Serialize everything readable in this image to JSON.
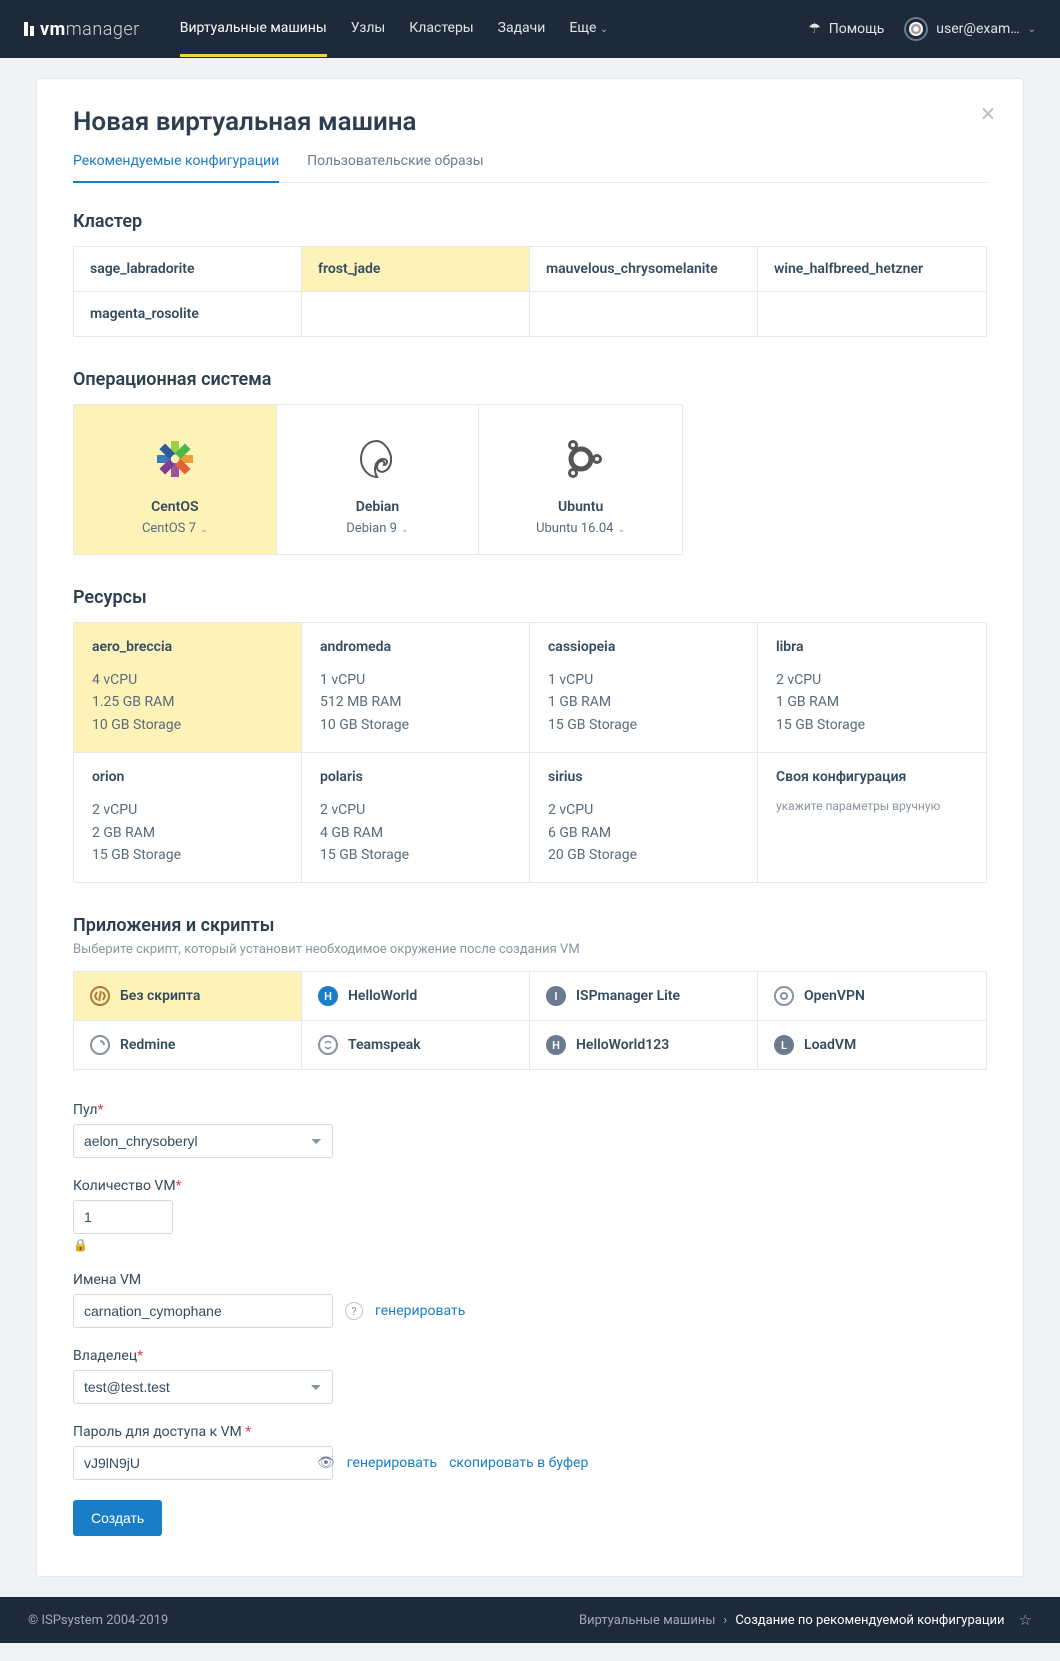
{
  "brand": {
    "bold": "vm",
    "thin": "manager"
  },
  "nav": {
    "items": [
      "Виртуальные машины",
      "Узлы",
      "Кластеры",
      "Задачи",
      "Еще"
    ],
    "active_index": 0
  },
  "header": {
    "help": "Помощь",
    "user": "user@exam…"
  },
  "page": {
    "title": "Новая виртуальная машина",
    "tabs": [
      "Рекомендуемые конфигурации",
      "Пользовательские образы"
    ],
    "active_tab": 0
  },
  "cluster": {
    "title": "Кластер",
    "items": [
      "sage_labradorite",
      "frost_jade",
      "mauvelous_chrysomelanite",
      "wine_halfbreed_hetzner",
      "magenta_rosolite"
    ],
    "selected_index": 1
  },
  "os": {
    "title": "Операционная система",
    "items": [
      {
        "name": "CentOS",
        "version": "CentOS 7"
      },
      {
        "name": "Debian",
        "version": "Debian 9"
      },
      {
        "name": "Ubuntu",
        "version": "Ubuntu 16.04"
      }
    ],
    "selected_index": 0
  },
  "resources": {
    "title": "Ресурсы",
    "items": [
      {
        "name": "aero_breccia",
        "cpu": "4 vCPU",
        "ram": "1.25 GB RAM",
        "storage": "10 GB Storage"
      },
      {
        "name": "andromeda",
        "cpu": "1 vCPU",
        "ram": "512 MB RAM",
        "storage": "10 GB Storage"
      },
      {
        "name": "cassiopeia",
        "cpu": "1 vCPU",
        "ram": "1 GB RAM",
        "storage": "15 GB Storage"
      },
      {
        "name": "libra",
        "cpu": "2 vCPU",
        "ram": "1 GB RAM",
        "storage": "15 GB Storage"
      },
      {
        "name": "orion",
        "cpu": "2 vCPU",
        "ram": "2 GB RAM",
        "storage": "15 GB Storage"
      },
      {
        "name": "polaris",
        "cpu": "2 vCPU",
        "ram": "4 GB RAM",
        "storage": "15 GB Storage"
      },
      {
        "name": "sirius",
        "cpu": "2 vCPU",
        "ram": "6 GB RAM",
        "storage": "20 GB Storage"
      }
    ],
    "custom": {
      "name": "Своя конфигурация",
      "sub": "укажите параметры вручную"
    },
    "selected_index": 0
  },
  "apps": {
    "title": "Приложения и скрипты",
    "sub": "Выберите скрипт, который установит необходимое окружение после создания VM",
    "items": [
      {
        "label": "Без скрипта",
        "icon": "empty"
      },
      {
        "label": "HelloWorld",
        "icon": "H",
        "color": "blue"
      },
      {
        "label": "ISPmanager Lite",
        "icon": "I",
        "color": "gray"
      },
      {
        "label": "OpenVPN",
        "icon": "vpn"
      },
      {
        "label": "Redmine",
        "icon": "redmine"
      },
      {
        "label": "Teamspeak",
        "icon": "ts"
      },
      {
        "label": "HelloWorld123",
        "icon": "H",
        "color": "gray"
      },
      {
        "label": "LoadVM",
        "icon": "L",
        "color": "gray"
      }
    ],
    "selected_index": 0
  },
  "form": {
    "pool": {
      "label": "Пул",
      "value": "aelon_chrysoberyl"
    },
    "count": {
      "label": "Количество VM",
      "value": "1"
    },
    "names": {
      "label": "Имена VM",
      "value": "carnation_cymophane",
      "generate": "генерировать"
    },
    "owner": {
      "label": "Владелец",
      "value": "test@test.test"
    },
    "password": {
      "label": "Пароль для доступа к VM",
      "value": "vJ9lN9jU",
      "generate": "генерировать",
      "copy": "скопировать в буфер"
    },
    "submit": "Создать"
  },
  "footer": {
    "copyright": "© ISPsystem 2004-2019",
    "crumb1": "Виртуальные машины",
    "crumb2": "Создание по рекомендуемой конфигурации"
  }
}
